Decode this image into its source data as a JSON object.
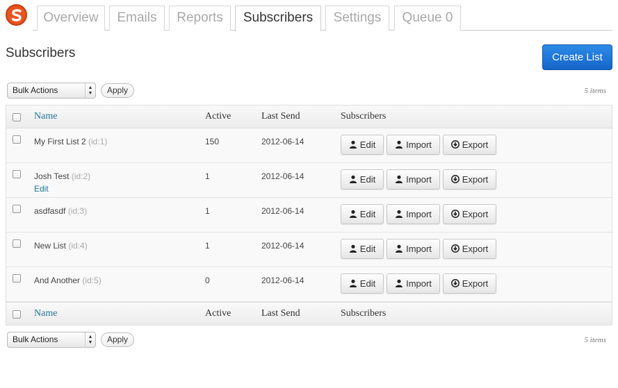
{
  "brand": {
    "logo_letter": "S",
    "accent": "#e9541f"
  },
  "tabs": [
    {
      "label": "Overview"
    },
    {
      "label": "Emails"
    },
    {
      "label": "Reports"
    },
    {
      "label": "Subscribers",
      "active": true
    },
    {
      "label": "Settings"
    },
    {
      "label": "Queue 0"
    }
  ],
  "page": {
    "title": "Subscribers",
    "create_button": "Create List"
  },
  "bulk_top": {
    "select_value": "Bulk Actions",
    "apply_label": "Apply",
    "count": "5 items"
  },
  "bulk_bottom": {
    "select_value": "Bulk Actions",
    "apply_label": "Apply",
    "count": "5 items"
  },
  "table": {
    "headers": {
      "name": "Name",
      "active": "Active",
      "last_send": "Last Send",
      "subscribers": "Subscribers"
    },
    "rows": [
      {
        "name": "My First List 2",
        "id": "(id:1)",
        "active": "150",
        "last_send": "2012-06-14",
        "row_action": ""
      },
      {
        "name": "Josh Test",
        "id": "(id:2)",
        "active": "1",
        "last_send": "2012-06-14",
        "row_action": "Edit"
      },
      {
        "name": "asdfasdf",
        "id": "(id:3)",
        "active": "1",
        "last_send": "2012-06-14",
        "row_action": ""
      },
      {
        "name": "New List",
        "id": "(id:4)",
        "active": "1",
        "last_send": "2012-06-14",
        "row_action": ""
      },
      {
        "name": "And Another",
        "id": "(id:5)",
        "active": "0",
        "last_send": "2012-06-14",
        "row_action": ""
      }
    ],
    "row_buttons": {
      "edit": "Edit",
      "import": "Import",
      "export": "Export"
    }
  },
  "icons": {
    "edit": "user-icon",
    "import": "user-icon",
    "export": "download-circle-icon"
  }
}
